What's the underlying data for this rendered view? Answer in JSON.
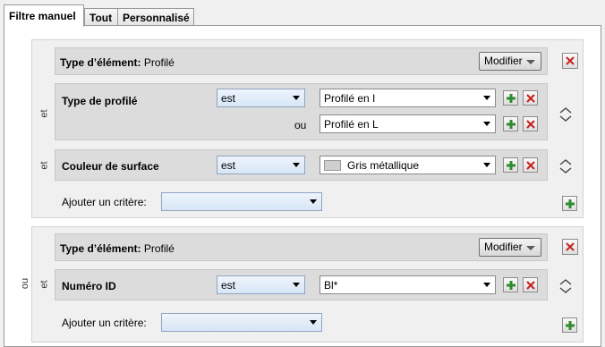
{
  "tabs": [
    {
      "label": "Filtre manuel",
      "active": true
    },
    {
      "label": "Tout",
      "active": false
    },
    {
      "label": "Personnalisé",
      "active": false
    }
  ],
  "group1": {
    "type_label": "Type d’élément:",
    "type_value": "Profilé",
    "modify_label": "Modifier",
    "et": "et",
    "criteria": [
      {
        "label": "Type de profilé",
        "operator": "est",
        "values": [
          "Profilé en I",
          "Profilé en L"
        ],
        "ou": "ou"
      },
      {
        "label": "Couleur de surface",
        "operator": "est",
        "value": "Gris métallique",
        "swatch_color": "#cfcfcf"
      }
    ],
    "add_label": "Ajouter un critère:",
    "add_value": ""
  },
  "between_groups": "ou",
  "group2": {
    "type_label": "Type d’élément:",
    "type_value": "Profilé",
    "modify_label": "Modifier",
    "et": "et",
    "criteria": [
      {
        "label": "Numéro ID",
        "operator": "est",
        "value": "Bl*"
      }
    ],
    "add_label": "Ajouter un critère:",
    "add_value": ""
  },
  "colors": {
    "add_green": "#2e8b2e",
    "remove_red": "#c81e1e",
    "dropdown_blue": "#d7e6f6"
  }
}
